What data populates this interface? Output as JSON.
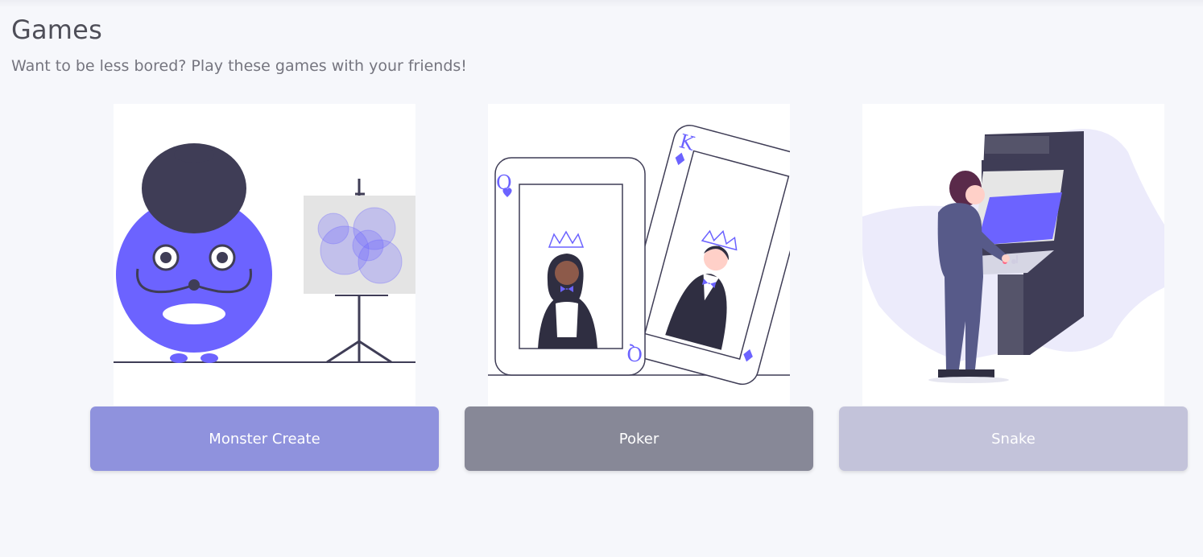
{
  "page": {
    "title": "Games",
    "subtitle": "Want to be less bored? Play these games with your friends!"
  },
  "games": [
    {
      "label": "Monster Create",
      "button_color": "#8f92dd",
      "illustration": "monster-and-easel"
    },
    {
      "label": "Poker",
      "button_color": "#878897",
      "illustration": "queen-and-king-cards"
    },
    {
      "label": "Snake",
      "button_color": "#c3c3da",
      "illustration": "arcade-player"
    }
  ],
  "cards": {
    "queen_letter": "Q",
    "king_letter": "K"
  },
  "colors": {
    "accent": "#6c63ff",
    "dark": "#3f3d56",
    "background": "#f6f7fb"
  }
}
